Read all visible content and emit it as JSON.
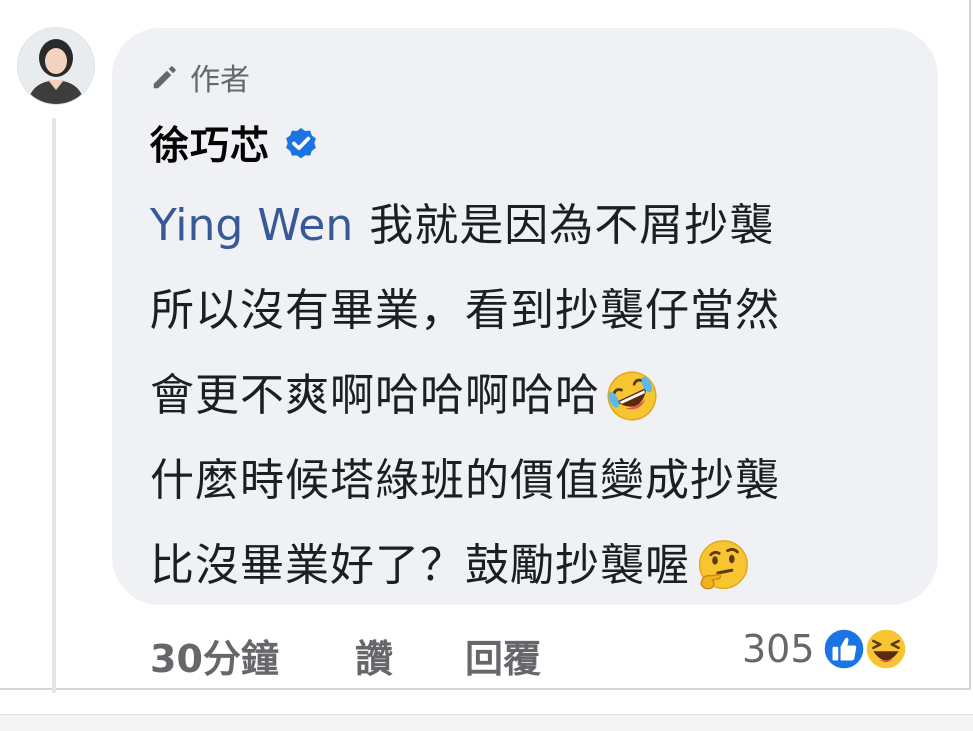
{
  "comment": {
    "author_badge": "作者",
    "author_name": "徐巧芯",
    "mention": "Ying Wen",
    "lines": [
      "我就是因為不屑抄襲",
      "所以沒有畢業，看到抄襲仔當然",
      "會更不爽啊哈哈啊哈哈",
      "什麼時候塔綠班的價值變成抄襲",
      "比沒畢業好了？鼓勵抄襲喔"
    ],
    "emojis": {
      "laughing_crying": "rolling-on-floor-laughing-emoji",
      "thinking": "thinking-face-emoji"
    }
  },
  "actions": {
    "time": "30分鐘",
    "like": "讚",
    "reply": "回覆"
  },
  "reactions": {
    "count": "305",
    "icons": [
      "like-reaction-icon",
      "haha-reaction-icon"
    ]
  },
  "colors": {
    "bubble": "#eff1f4",
    "mention": "#385898",
    "verified": "#1b74e4",
    "meta_text": "#65676b"
  }
}
